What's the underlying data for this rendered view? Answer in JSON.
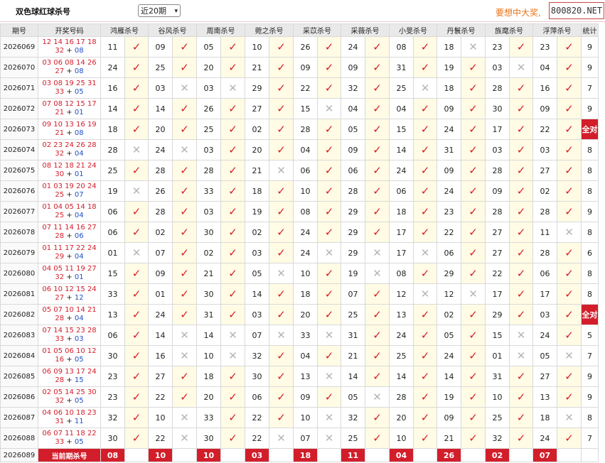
{
  "toolbar": {
    "title": "双色球红球杀号",
    "period_select": "近20期",
    "promo": "要想中大奖,",
    "site": "800820.NET"
  },
  "table": {
    "headers": [
      "期号",
      "开奖号码",
      "鸿雁杀号",
      "谷风杀号",
      "周南杀号",
      "菀之杀号",
      "采苡杀号",
      "采薇杀号",
      "小旻杀号",
      "丹鬟杀号",
      "旌麾杀号",
      "浮萍杀号",
      "统计"
    ],
    "rows": [
      {
        "issue": "2026069",
        "reds": "12 14 16 17 18",
        "reds2": "32",
        "blue": "08",
        "kills": [
          [
            "11",
            true
          ],
          [
            "09",
            true
          ],
          [
            "05",
            true
          ],
          [
            "10",
            true
          ],
          [
            "26",
            true
          ],
          [
            "24",
            true
          ],
          [
            "08",
            true
          ],
          [
            "18",
            false
          ],
          [
            "23",
            true
          ],
          [
            "23",
            true
          ]
        ],
        "stat": "9"
      },
      {
        "issue": "2026070",
        "reds": "03 06 08 14 26",
        "reds2": "27",
        "blue": "08",
        "kills": [
          [
            "24",
            true
          ],
          [
            "25",
            true
          ],
          [
            "20",
            true
          ],
          [
            "21",
            true
          ],
          [
            "09",
            true
          ],
          [
            "09",
            true
          ],
          [
            "31",
            true
          ],
          [
            "19",
            true
          ],
          [
            "03",
            false
          ],
          [
            "04",
            true
          ]
        ],
        "stat": "9"
      },
      {
        "issue": "2026071",
        "reds": "03 08 19 25 31",
        "reds2": "33",
        "blue": "05",
        "kills": [
          [
            "16",
            true
          ],
          [
            "03",
            false
          ],
          [
            "03",
            false
          ],
          [
            "29",
            true
          ],
          [
            "22",
            true
          ],
          [
            "32",
            true
          ],
          [
            "25",
            false
          ],
          [
            "18",
            true
          ],
          [
            "28",
            true
          ],
          [
            "16",
            true
          ]
        ],
        "stat": "7"
      },
      {
        "issue": "2026072",
        "reds": "07 08 12 15 17",
        "reds2": "21",
        "blue": "01",
        "kills": [
          [
            "14",
            true
          ],
          [
            "14",
            true
          ],
          [
            "26",
            true
          ],
          [
            "27",
            true
          ],
          [
            "15",
            false
          ],
          [
            "04",
            true
          ],
          [
            "04",
            true
          ],
          [
            "09",
            true
          ],
          [
            "30",
            true
          ],
          [
            "09",
            true
          ]
        ],
        "stat": "9"
      },
      {
        "issue": "2026073",
        "reds": "09 10 13 16 19",
        "reds2": "21",
        "blue": "08",
        "kills": [
          [
            "18",
            true
          ],
          [
            "20",
            true
          ],
          [
            "25",
            true
          ],
          [
            "02",
            true
          ],
          [
            "28",
            true
          ],
          [
            "05",
            true
          ],
          [
            "15",
            true
          ],
          [
            "24",
            true
          ],
          [
            "17",
            true
          ],
          [
            "22",
            true
          ]
        ],
        "stat": "全对"
      },
      {
        "issue": "2026074",
        "reds": "02 23 24 26 28",
        "reds2": "32",
        "blue": "04",
        "kills": [
          [
            "28",
            false
          ],
          [
            "24",
            false
          ],
          [
            "03",
            true
          ],
          [
            "20",
            true
          ],
          [
            "04",
            true
          ],
          [
            "09",
            true
          ],
          [
            "14",
            true
          ],
          [
            "31",
            true
          ],
          [
            "03",
            true
          ],
          [
            "03",
            true
          ]
        ],
        "stat": "8"
      },
      {
        "issue": "2026075",
        "reds": "08 12 18 21 24",
        "reds2": "30",
        "blue": "01",
        "kills": [
          [
            "25",
            true
          ],
          [
            "28",
            true
          ],
          [
            "28",
            true
          ],
          [
            "21",
            false
          ],
          [
            "06",
            true
          ],
          [
            "06",
            true
          ],
          [
            "24",
            true
          ],
          [
            "09",
            true
          ],
          [
            "28",
            true
          ],
          [
            "27",
            true
          ]
        ],
        "stat": "8"
      },
      {
        "issue": "2026076",
        "reds": "01 03 19 20 24",
        "reds2": "25",
        "blue": "07",
        "kills": [
          [
            "19",
            false
          ],
          [
            "26",
            true
          ],
          [
            "33",
            true
          ],
          [
            "18",
            true
          ],
          [
            "10",
            true
          ],
          [
            "28",
            true
          ],
          [
            "06",
            true
          ],
          [
            "24",
            true
          ],
          [
            "09",
            true
          ],
          [
            "02",
            true
          ]
        ],
        "stat": "8"
      },
      {
        "issue": "2026077",
        "reds": "01 04 05 14 18",
        "reds2": "25",
        "blue": "04",
        "kills": [
          [
            "06",
            true
          ],
          [
            "28",
            true
          ],
          [
            "03",
            true
          ],
          [
            "19",
            true
          ],
          [
            "08",
            true
          ],
          [
            "29",
            true
          ],
          [
            "18",
            true
          ],
          [
            "23",
            true
          ],
          [
            "28",
            true
          ],
          [
            "28",
            true
          ]
        ],
        "stat": "9"
      },
      {
        "issue": "2026078",
        "reds": "07 11 14 16 27",
        "reds2": "28",
        "blue": "06",
        "kills": [
          [
            "06",
            true
          ],
          [
            "02",
            true
          ],
          [
            "30",
            true
          ],
          [
            "02",
            true
          ],
          [
            "24",
            true
          ],
          [
            "29",
            true
          ],
          [
            "17",
            true
          ],
          [
            "22",
            true
          ],
          [
            "27",
            true
          ],
          [
            "11",
            false
          ]
        ],
        "stat": "8"
      },
      {
        "issue": "2026079",
        "reds": "01 11 17 22 24",
        "reds2": "29",
        "blue": "04",
        "kills": [
          [
            "01",
            false
          ],
          [
            "07",
            true
          ],
          [
            "02",
            true
          ],
          [
            "03",
            true
          ],
          [
            "24",
            false
          ],
          [
            "29",
            false
          ],
          [
            "17",
            false
          ],
          [
            "06",
            true
          ],
          [
            "27",
            true
          ],
          [
            "28",
            true
          ]
        ],
        "stat": "6"
      },
      {
        "issue": "2026080",
        "reds": "04 05 11 19 27",
        "reds2": "32",
        "blue": "01",
        "kills": [
          [
            "15",
            true
          ],
          [
            "09",
            true
          ],
          [
            "21",
            true
          ],
          [
            "05",
            false
          ],
          [
            "10",
            true
          ],
          [
            "19",
            false
          ],
          [
            "08",
            true
          ],
          [
            "29",
            true
          ],
          [
            "22",
            true
          ],
          [
            "06",
            true
          ]
        ],
        "stat": "8"
      },
      {
        "issue": "2026081",
        "reds": "06 10 12 15 24",
        "reds2": "27",
        "blue": "12",
        "kills": [
          [
            "33",
            true
          ],
          [
            "01",
            true
          ],
          [
            "30",
            true
          ],
          [
            "14",
            true
          ],
          [
            "18",
            true
          ],
          [
            "07",
            true
          ],
          [
            "12",
            false
          ],
          [
            "12",
            false
          ],
          [
            "17",
            true
          ],
          [
            "17",
            true
          ]
        ],
        "stat": "8"
      },
      {
        "issue": "2026082",
        "reds": "05 07 10 14 21",
        "reds2": "28",
        "blue": "04",
        "kills": [
          [
            "13",
            true
          ],
          [
            "24",
            true
          ],
          [
            "31",
            true
          ],
          [
            "03",
            true
          ],
          [
            "20",
            true
          ],
          [
            "25",
            true
          ],
          [
            "13",
            true
          ],
          [
            "02",
            true
          ],
          [
            "29",
            true
          ],
          [
            "03",
            true
          ]
        ],
        "stat": "全对"
      },
      {
        "issue": "2026083",
        "reds": "07 14 15 23 28",
        "reds2": "33",
        "blue": "03",
        "kills": [
          [
            "06",
            true
          ],
          [
            "14",
            false
          ],
          [
            "14",
            false
          ],
          [
            "07",
            false
          ],
          [
            "33",
            false
          ],
          [
            "31",
            true
          ],
          [
            "24",
            true
          ],
          [
            "05",
            true
          ],
          [
            "15",
            false
          ],
          [
            "24",
            true
          ]
        ],
        "stat": "5"
      },
      {
        "issue": "2026084",
        "reds": "01 05 06 10 12",
        "reds2": "16",
        "blue": "05",
        "kills": [
          [
            "30",
            true
          ],
          [
            "16",
            false
          ],
          [
            "10",
            false
          ],
          [
            "32",
            true
          ],
          [
            "04",
            true
          ],
          [
            "21",
            true
          ],
          [
            "25",
            true
          ],
          [
            "24",
            true
          ],
          [
            "01",
            false
          ],
          [
            "05",
            false
          ]
        ],
        "stat": "7"
      },
      {
        "issue": "2026085",
        "reds": "06 09 13 17 24",
        "reds2": "28",
        "blue": "15",
        "kills": [
          [
            "23",
            true
          ],
          [
            "27",
            true
          ],
          [
            "18",
            true
          ],
          [
            "30",
            true
          ],
          [
            "13",
            false
          ],
          [
            "14",
            true
          ],
          [
            "14",
            true
          ],
          [
            "14",
            true
          ],
          [
            "31",
            true
          ],
          [
            "27",
            true
          ]
        ],
        "stat": "9"
      },
      {
        "issue": "2026086",
        "reds": "02 05 14 25 30",
        "reds2": "32",
        "blue": "05",
        "kills": [
          [
            "23",
            true
          ],
          [
            "22",
            true
          ],
          [
            "20",
            true
          ],
          [
            "06",
            true
          ],
          [
            "09",
            true
          ],
          [
            "05",
            false
          ],
          [
            "28",
            true
          ],
          [
            "19",
            true
          ],
          [
            "10",
            true
          ],
          [
            "13",
            true
          ]
        ],
        "stat": "9"
      },
      {
        "issue": "2026087",
        "reds": "04 06 10 18 23",
        "reds2": "31",
        "blue": "11",
        "kills": [
          [
            "32",
            true
          ],
          [
            "10",
            false
          ],
          [
            "33",
            true
          ],
          [
            "22",
            true
          ],
          [
            "10",
            false
          ],
          [
            "32",
            true
          ],
          [
            "20",
            true
          ],
          [
            "09",
            true
          ],
          [
            "25",
            true
          ],
          [
            "18",
            false
          ]
        ],
        "stat": "8"
      },
      {
        "issue": "2026088",
        "reds": "06 07 11 18 22",
        "reds2": "33",
        "blue": "05",
        "kills": [
          [
            "30",
            true
          ],
          [
            "22",
            false
          ],
          [
            "30",
            true
          ],
          [
            "22",
            false
          ],
          [
            "07",
            false
          ],
          [
            "25",
            true
          ],
          [
            "10",
            true
          ],
          [
            "21",
            true
          ],
          [
            "32",
            true
          ],
          [
            "24",
            true
          ]
        ],
        "stat": "7"
      }
    ],
    "current": {
      "issue": "2026089",
      "label": "当前期杀号",
      "kills": [
        "08",
        "10",
        "10",
        "03",
        "18",
        "11",
        "04",
        "26",
        "02",
        "07"
      ]
    },
    "marks": {
      "ok": "✓",
      "bad": "✕"
    }
  },
  "colors": {
    "accent": "#d21e2b",
    "blue": "#1f4fc7",
    "hit_bg": "#fffbe4"
  }
}
